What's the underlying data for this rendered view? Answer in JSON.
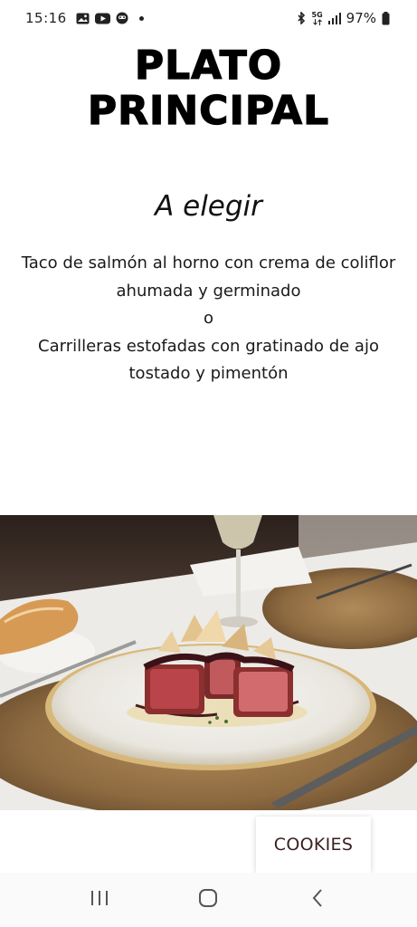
{
  "status_bar": {
    "time": "15:16",
    "icons": [
      "gallery-icon",
      "youtube-icon",
      "assistant-icon",
      "notification-dot"
    ],
    "right_icons": [
      "bluetooth-icon",
      "5g-icon",
      "signal-icon",
      "battery-icon"
    ],
    "network": "5G",
    "battery": "97%"
  },
  "header": {
    "title_line1": "PLATO",
    "title_line2": "PRINCIPAL"
  },
  "menu": {
    "subtitle": "A elegir",
    "line1": "Taco de salmón al horno con crema de coliflor",
    "line2": "ahumada y germinado",
    "separator": "o",
    "line3": "Carrilleras estofadas con gratinado de ajo",
    "line4": "tostado y pimentón"
  },
  "cookies": {
    "label": "COOKIES"
  },
  "nav": {
    "buttons": [
      "recent-apps-icon",
      "home-icon",
      "back-icon"
    ]
  },
  "colors": {
    "background": "#ffffff",
    "text": "#111111",
    "cookies_text": "#3a1f1f"
  }
}
